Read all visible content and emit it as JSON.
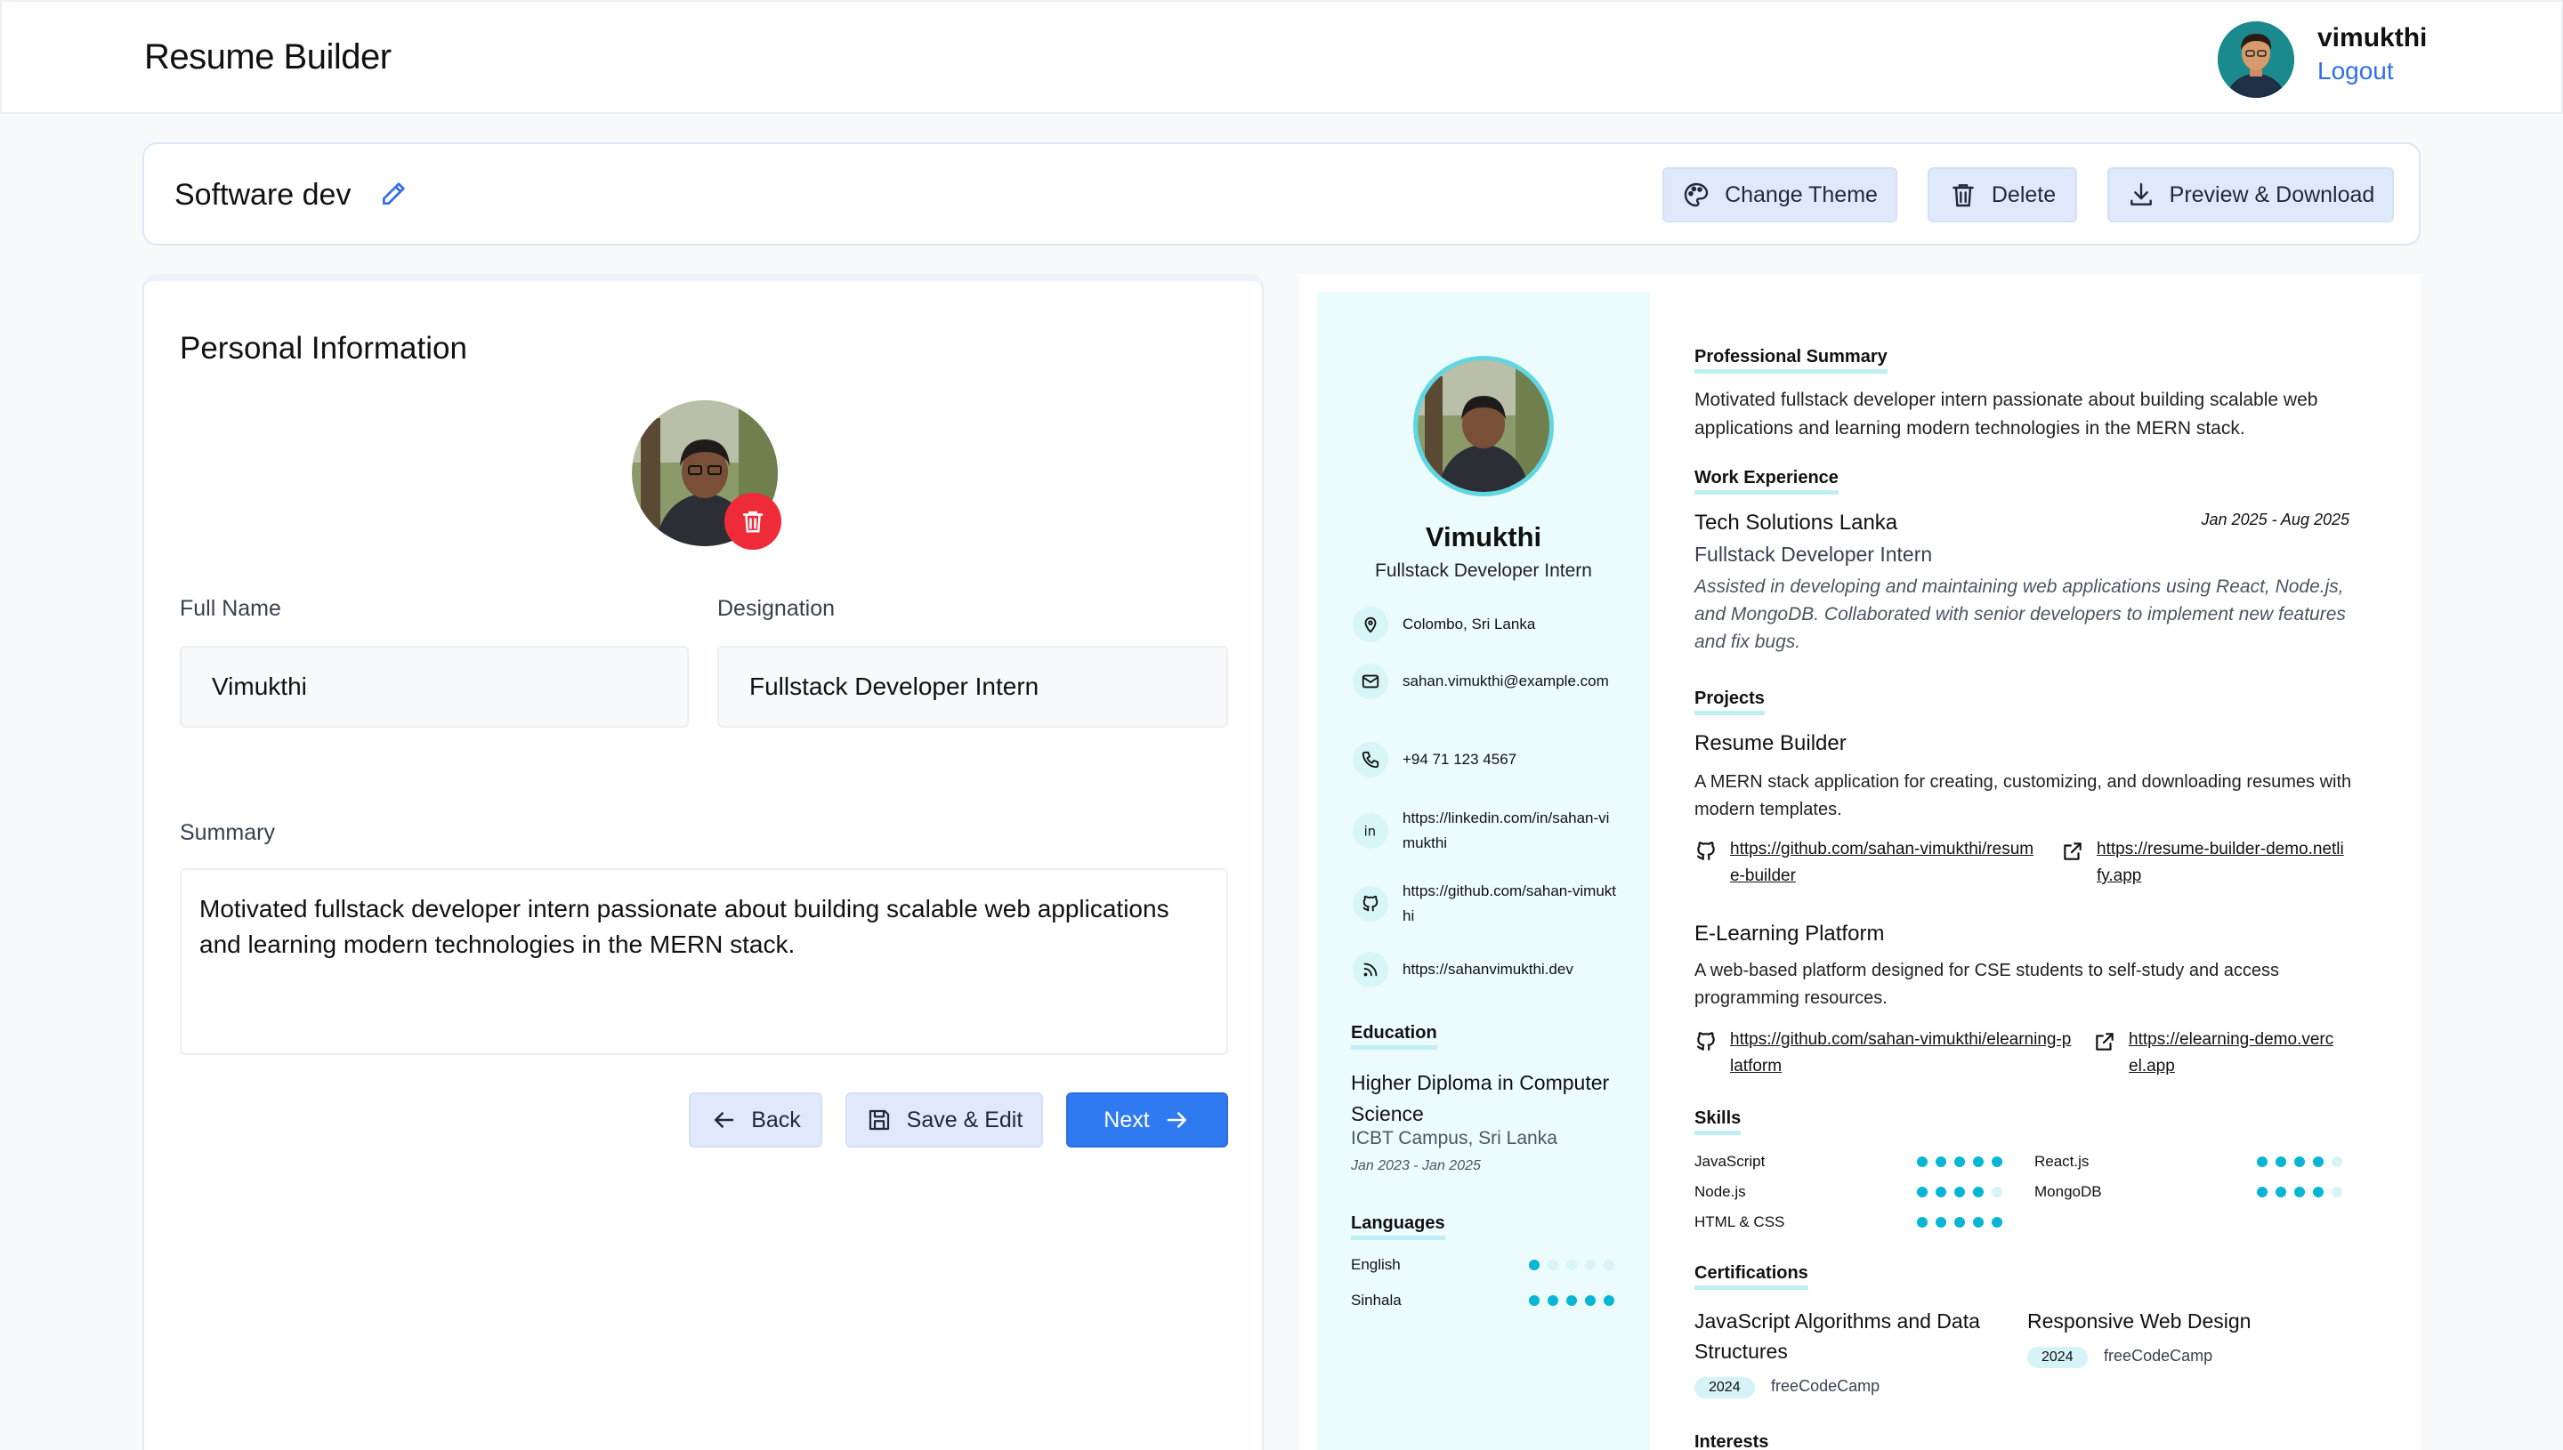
{
  "header": {
    "app_title": "Resume Builder",
    "user_name": "vimukthi",
    "logout_label": "Logout"
  },
  "toolbar": {
    "resume_title": "Software dev",
    "change_theme_label": "Change Theme",
    "delete_label": "Delete",
    "preview_download_label": "Preview & Download"
  },
  "form": {
    "section_title": "Personal Information",
    "full_name_label": "Full Name",
    "full_name_value": "Vimukthi",
    "designation_label": "Designation",
    "designation_value": "Fullstack Developer Intern",
    "summary_label": "Summary",
    "summary_value": "Motivated fullstack developer intern passionate about building scalable web applications and learning modern technologies in the MERN stack.",
    "back_label": "Back",
    "save_edit_label": "Save & Edit",
    "next_label": "Next"
  },
  "preview": {
    "name": "Vimukthi",
    "role": "Fullstack Developer Intern",
    "contacts": [
      {
        "icon": "location-icon",
        "text": "Colombo, Sri Lanka"
      },
      {
        "icon": "email-icon",
        "text": "sahan.vimukthi@example.com"
      },
      {
        "icon": "phone-icon",
        "text": "+94 71 123 4567"
      },
      {
        "icon": "linkedin-icon",
        "text": "https://linkedin.com/in/sahan-vimukthi"
      },
      {
        "icon": "github-icon",
        "text": "https://github.com/sahan-vimukthi"
      },
      {
        "icon": "rss-icon",
        "text": "https://sahanvimukthi.dev"
      }
    ],
    "education": {
      "heading": "Education",
      "degree": "Higher Diploma in Computer Science",
      "institution": "ICBT Campus, Sri Lanka",
      "dates": "Jan 2023 - Jan 2025"
    },
    "languages": {
      "heading": "Languages",
      "items": [
        {
          "name": "English",
          "level": 1,
          "max": 5
        },
        {
          "name": "Sinhala",
          "level": 5,
          "max": 5
        }
      ]
    },
    "summary": {
      "heading": "Professional Summary",
      "text": "Motivated fullstack developer intern passionate about building scalable web applications and learning modern technologies in the MERN stack."
    },
    "experience": {
      "heading": "Work Experience",
      "company": "Tech Solutions Lanka",
      "dates": "Jan 2025 - Aug 2025",
      "position": "Fullstack Developer Intern",
      "description": "Assisted in developing and maintaining web applications using React, Node.js, and MongoDB. Collaborated with senior developers to implement new features and fix bugs."
    },
    "projects": {
      "heading": "Projects",
      "items": [
        {
          "title": "Resume Builder",
          "description": "A MERN stack application for creating, customizing, and downloading resumes with modern templates.",
          "github": "https://github.com/sahan-vimukthi/resume-builder",
          "live": "https://resume-builder-demo.netlify.app"
        },
        {
          "title": "E-Learning Platform",
          "description": "A web-based platform designed for CSE students to self-study and access programming resources.",
          "github": "https://github.com/sahan-vimukthi/elearning-platform",
          "live": "https://elearning-demo.vercel.app"
        }
      ]
    },
    "skills": {
      "heading": "Skills",
      "items": [
        {
          "name": "JavaScript",
          "level": 5,
          "max": 5
        },
        {
          "name": "React.js",
          "level": 4,
          "max": 5
        },
        {
          "name": "Node.js",
          "level": 4,
          "max": 5
        },
        {
          "name": "MongoDB",
          "level": 4,
          "max": 5
        },
        {
          "name": "HTML & CSS",
          "level": 5,
          "max": 5
        }
      ]
    },
    "certifications": {
      "heading": "Certifications",
      "items": [
        {
          "title": "JavaScript Algorithms and Data Structures",
          "year": "2024",
          "org": "freeCodeCamp"
        },
        {
          "title": "Responsive Web Design",
          "year": "2024",
          "org": "freeCodeCamp"
        }
      ]
    },
    "interests": {
      "heading": "Interests"
    }
  },
  "colors": {
    "accent": "#2f7af0",
    "preview_accent": "#06b6d4",
    "danger": "#ef2b3a",
    "sidebar_bg": "#ecfcfd"
  }
}
